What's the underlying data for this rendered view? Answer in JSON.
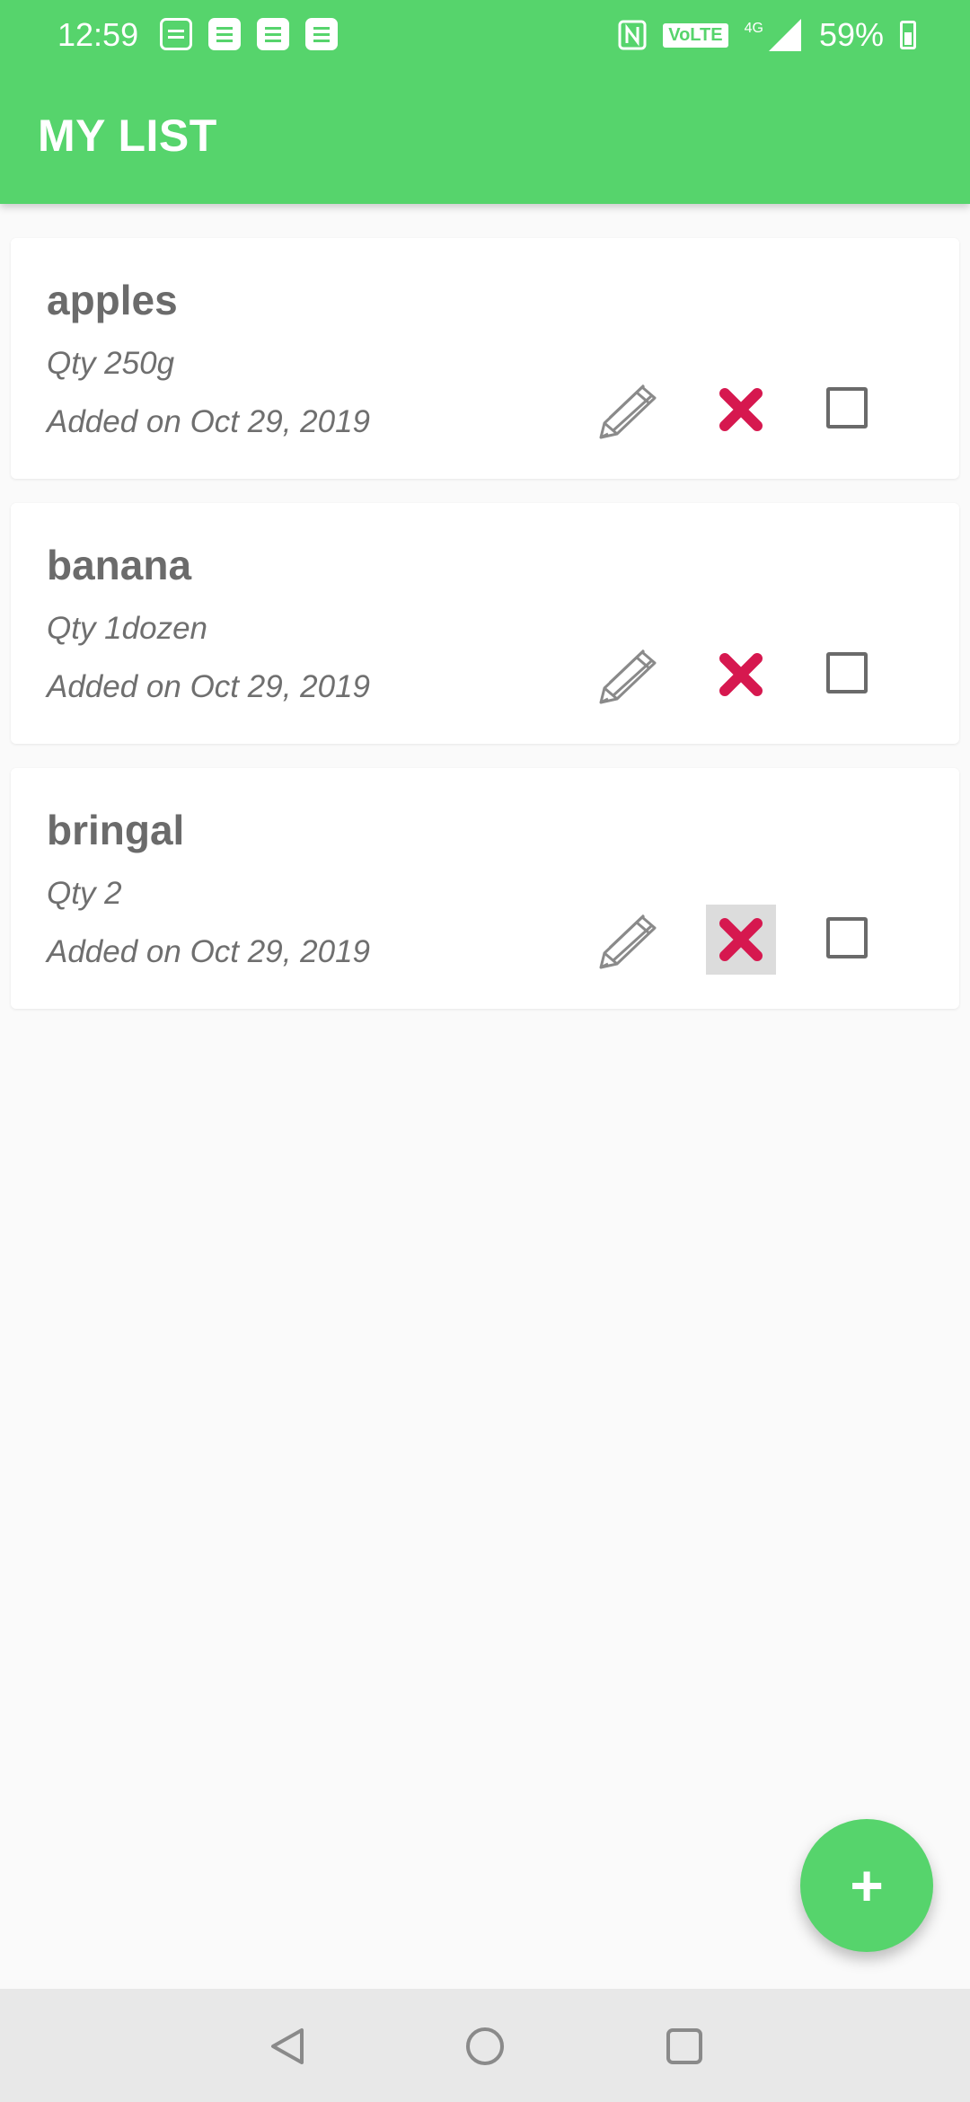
{
  "status_bar": {
    "time": "12:59",
    "volte": "VoLTE",
    "network": "4G",
    "battery": "59%"
  },
  "app_bar": {
    "title": "MY LIST"
  },
  "items": [
    {
      "name": "apples",
      "qty": "Qty 250g",
      "added": "Added on Oct 29, 2019"
    },
    {
      "name": "banana",
      "qty": "Qty 1dozen",
      "added": "Added on Oct 29, 2019"
    },
    {
      "name": "bringal",
      "qty": "Qty 2",
      "added": "Added on Oct 29, 2019"
    }
  ],
  "fab": {
    "label": "+"
  },
  "colors": {
    "accent": "#56d46c",
    "delete": "#d6184f",
    "text": "#6b6b6b"
  },
  "icons": {
    "edit": "pencil-icon",
    "delete": "close-icon",
    "check": "checkbox-icon",
    "nav_back": "back-triangle-icon",
    "nav_home": "home-circle-icon",
    "nav_recents": "recents-square-icon"
  }
}
